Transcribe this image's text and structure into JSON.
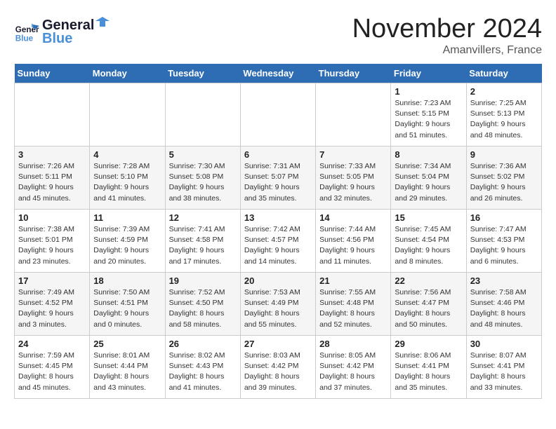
{
  "logo": {
    "text_general": "General",
    "text_blue": "Blue"
  },
  "header": {
    "month": "November 2024",
    "location": "Amanvillers, France"
  },
  "days_of_week": [
    "Sunday",
    "Monday",
    "Tuesday",
    "Wednesday",
    "Thursday",
    "Friday",
    "Saturday"
  ],
  "weeks": [
    [
      {
        "day": "",
        "info": ""
      },
      {
        "day": "",
        "info": ""
      },
      {
        "day": "",
        "info": ""
      },
      {
        "day": "",
        "info": ""
      },
      {
        "day": "",
        "info": ""
      },
      {
        "day": "1",
        "info": "Sunrise: 7:23 AM\nSunset: 5:15 PM\nDaylight: 9 hours and 51 minutes."
      },
      {
        "day": "2",
        "info": "Sunrise: 7:25 AM\nSunset: 5:13 PM\nDaylight: 9 hours and 48 minutes."
      }
    ],
    [
      {
        "day": "3",
        "info": "Sunrise: 7:26 AM\nSunset: 5:11 PM\nDaylight: 9 hours and 45 minutes."
      },
      {
        "day": "4",
        "info": "Sunrise: 7:28 AM\nSunset: 5:10 PM\nDaylight: 9 hours and 41 minutes."
      },
      {
        "day": "5",
        "info": "Sunrise: 7:30 AM\nSunset: 5:08 PM\nDaylight: 9 hours and 38 minutes."
      },
      {
        "day": "6",
        "info": "Sunrise: 7:31 AM\nSunset: 5:07 PM\nDaylight: 9 hours and 35 minutes."
      },
      {
        "day": "7",
        "info": "Sunrise: 7:33 AM\nSunset: 5:05 PM\nDaylight: 9 hours and 32 minutes."
      },
      {
        "day": "8",
        "info": "Sunrise: 7:34 AM\nSunset: 5:04 PM\nDaylight: 9 hours and 29 minutes."
      },
      {
        "day": "9",
        "info": "Sunrise: 7:36 AM\nSunset: 5:02 PM\nDaylight: 9 hours and 26 minutes."
      }
    ],
    [
      {
        "day": "10",
        "info": "Sunrise: 7:38 AM\nSunset: 5:01 PM\nDaylight: 9 hours and 23 minutes."
      },
      {
        "day": "11",
        "info": "Sunrise: 7:39 AM\nSunset: 4:59 PM\nDaylight: 9 hours and 20 minutes."
      },
      {
        "day": "12",
        "info": "Sunrise: 7:41 AM\nSunset: 4:58 PM\nDaylight: 9 hours and 17 minutes."
      },
      {
        "day": "13",
        "info": "Sunrise: 7:42 AM\nSunset: 4:57 PM\nDaylight: 9 hours and 14 minutes."
      },
      {
        "day": "14",
        "info": "Sunrise: 7:44 AM\nSunset: 4:56 PM\nDaylight: 9 hours and 11 minutes."
      },
      {
        "day": "15",
        "info": "Sunrise: 7:45 AM\nSunset: 4:54 PM\nDaylight: 9 hours and 8 minutes."
      },
      {
        "day": "16",
        "info": "Sunrise: 7:47 AM\nSunset: 4:53 PM\nDaylight: 9 hours and 6 minutes."
      }
    ],
    [
      {
        "day": "17",
        "info": "Sunrise: 7:49 AM\nSunset: 4:52 PM\nDaylight: 9 hours and 3 minutes."
      },
      {
        "day": "18",
        "info": "Sunrise: 7:50 AM\nSunset: 4:51 PM\nDaylight: 9 hours and 0 minutes."
      },
      {
        "day": "19",
        "info": "Sunrise: 7:52 AM\nSunset: 4:50 PM\nDaylight: 8 hours and 58 minutes."
      },
      {
        "day": "20",
        "info": "Sunrise: 7:53 AM\nSunset: 4:49 PM\nDaylight: 8 hours and 55 minutes."
      },
      {
        "day": "21",
        "info": "Sunrise: 7:55 AM\nSunset: 4:48 PM\nDaylight: 8 hours and 52 minutes."
      },
      {
        "day": "22",
        "info": "Sunrise: 7:56 AM\nSunset: 4:47 PM\nDaylight: 8 hours and 50 minutes."
      },
      {
        "day": "23",
        "info": "Sunrise: 7:58 AM\nSunset: 4:46 PM\nDaylight: 8 hours and 48 minutes."
      }
    ],
    [
      {
        "day": "24",
        "info": "Sunrise: 7:59 AM\nSunset: 4:45 PM\nDaylight: 8 hours and 45 minutes."
      },
      {
        "day": "25",
        "info": "Sunrise: 8:01 AM\nSunset: 4:44 PM\nDaylight: 8 hours and 43 minutes."
      },
      {
        "day": "26",
        "info": "Sunrise: 8:02 AM\nSunset: 4:43 PM\nDaylight: 8 hours and 41 minutes."
      },
      {
        "day": "27",
        "info": "Sunrise: 8:03 AM\nSunset: 4:42 PM\nDaylight: 8 hours and 39 minutes."
      },
      {
        "day": "28",
        "info": "Sunrise: 8:05 AM\nSunset: 4:42 PM\nDaylight: 8 hours and 37 minutes."
      },
      {
        "day": "29",
        "info": "Sunrise: 8:06 AM\nSunset: 4:41 PM\nDaylight: 8 hours and 35 minutes."
      },
      {
        "day": "30",
        "info": "Sunrise: 8:07 AM\nSunset: 4:41 PM\nDaylight: 8 hours and 33 minutes."
      }
    ]
  ]
}
